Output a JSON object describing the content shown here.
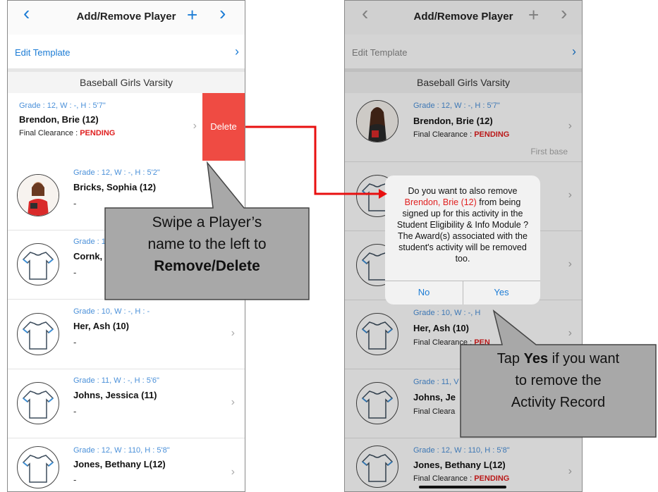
{
  "nav": {
    "title": "Add/Remove Player",
    "back_icon": "‹",
    "add_icon": "+",
    "forward_icon": "›"
  },
  "edit_template": {
    "label": "Edit Template",
    "chevron": "›"
  },
  "section": {
    "title": "Baseball Girls Varsity"
  },
  "players": [
    {
      "grade": "Grade : 12, W : -, H : 5'7\"",
      "name": "Brendon, Brie (12)",
      "clearance_label": "Final Clearance : ",
      "clearance_status": "PENDING",
      "position": "First base",
      "avatar": "photo"
    },
    {
      "grade": "Grade : 12, W : -, H : 5'2\"",
      "name": "Bricks, Sophia (12)",
      "dash": "-",
      "avatar": "photo"
    },
    {
      "grade": "Grade : 1",
      "name": "Cornk,",
      "dash": "-",
      "avatar": "shirt"
    },
    {
      "grade": "Grade : 10, W : -, H : -",
      "name": "Her, Ash (10)",
      "dash": "-",
      "clearance_label": "Final Clearance : ",
      "clearance_status": "PEN",
      "grade_partial": "Grade : 10, W : -, H",
      "avatar": "shirt"
    },
    {
      "grade": "Grade : 11, W : -, H : 5'6\"",
      "grade_partial": "Grade : 11, V",
      "name": "Johns, Jessica (11)",
      "name_partial": "Johns, Je",
      "dash": "-",
      "clearance_label": "Final Cleara",
      "avatar": "shirt"
    },
    {
      "grade": "Grade : 12, W : 110, H : 5'8\"",
      "name": "Jones, Bethany L(12)",
      "dash": "-",
      "clearance_label": "Final Clearance : ",
      "clearance_status": "PENDING",
      "avatar": "shirt"
    }
  ],
  "delete_label": "Delete",
  "dialog": {
    "line1": "Do you want to also remove",
    "player": "Brendon, Brie (12)",
    "line2": " from being signed up for this activity in the Student Eligibility & Info Module ? The Award(s) associated with the student's activity will be removed too.",
    "no_label": "No",
    "yes_label": "Yes"
  },
  "callout_left": {
    "line1": "Swipe a Player’s",
    "line2": "name to the left to",
    "line3": "Remove/Delete"
  },
  "callout_right": {
    "tap": "Tap ",
    "yes": "Yes",
    "rest": " if you want",
    "line2": "to remove the",
    "line3": "Activity Record"
  },
  "colors": {
    "accent": "#1c7cd5",
    "pending": "#e02020",
    "delete": "#ef4b43",
    "arrow": "#e81010",
    "callout": "#a8a8a8"
  }
}
